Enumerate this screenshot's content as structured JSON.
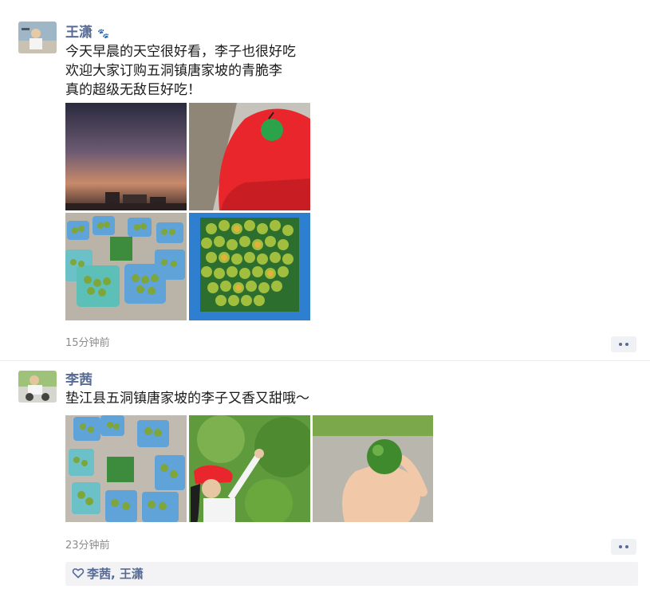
{
  "posts": [
    {
      "author": "王潇",
      "text_lines": [
        "今天早晨的天空很好看，李子也很好吃",
        "欢迎大家订购五洞镇唐家坡的青脆李",
        "真的超级无敌巨好吃！"
      ],
      "photos": [
        "sunset-sky-photo",
        "red-cap-photo",
        "plum-baskets-photo",
        "plum-basket-closeup-photo"
      ],
      "time": "15分钟前"
    },
    {
      "author": "李茜",
      "text_lines": [
        "垫江县五洞镇唐家坡的李子又香又甜哦～"
      ],
      "photos": [
        "plum-baskets-circle-photo",
        "picking-plums-photo",
        "plum-in-hand-photo"
      ],
      "time": "23分钟前",
      "likes": "李茜, 王潇"
    }
  ],
  "icons": [
    "paw-icon",
    "more-icon",
    "heart-icon"
  ],
  "colors": {
    "name_link": "#576b95",
    "time": "#8c8c8c",
    "cap_red": "#e8262c",
    "plum_green": "#6aa636"
  }
}
